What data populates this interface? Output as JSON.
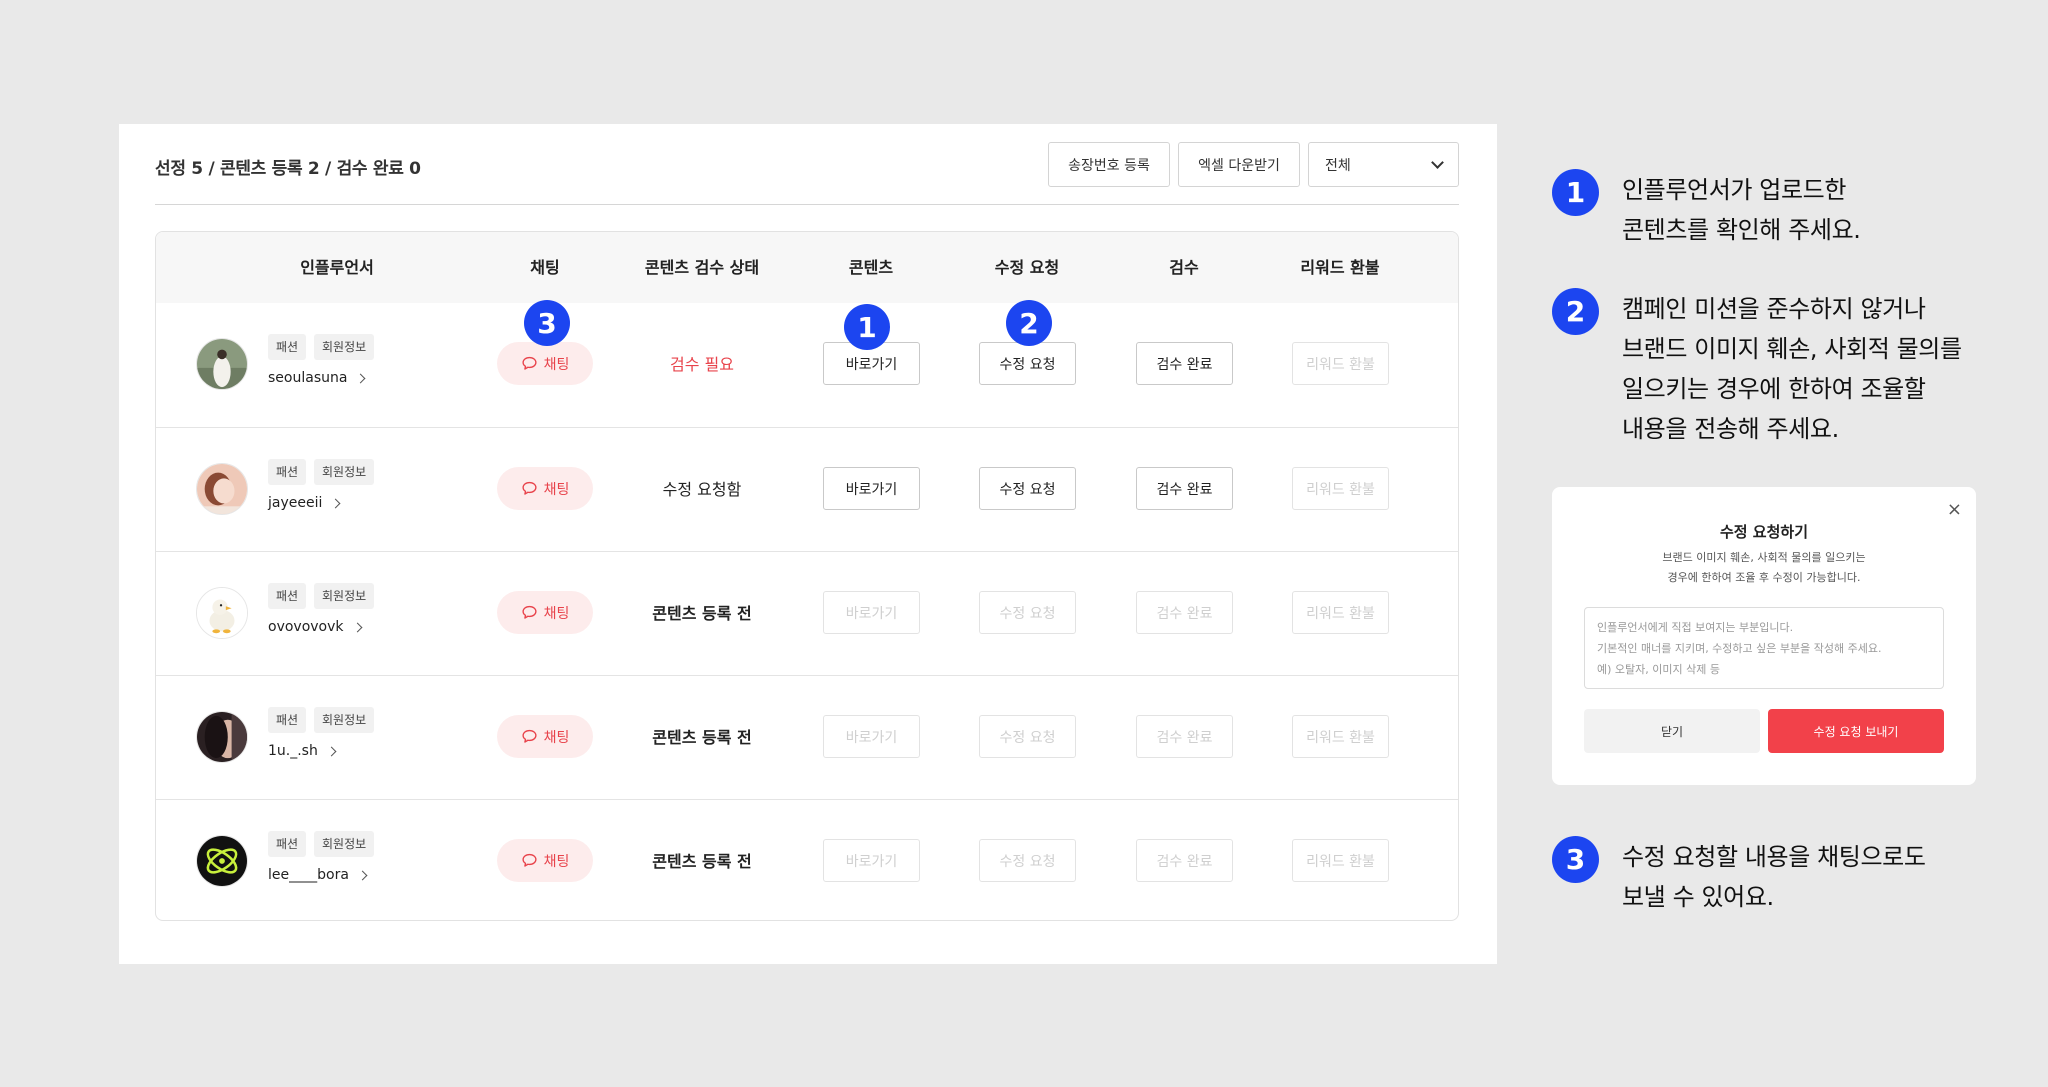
{
  "toolbar": {
    "summary": "선정 5 / 콘텐츠 등록 2 / 검수 완료 0",
    "register_tracking_label": "송장번호 등록",
    "excel_download_label": "엑셀 다운받기",
    "filter_selected": "전체"
  },
  "table": {
    "headers": [
      "인플루언서",
      "채팅",
      "콘텐츠 검수 상태",
      "콘텐츠",
      "수정 요청",
      "검수",
      "리워드 환불"
    ],
    "rows": [
      {
        "category": "패션",
        "member_info": "회원정보",
        "username": "seoulasuna",
        "chat": "채팅",
        "status": "검수 필요",
        "goto": "바로가기",
        "revise": "수정 요청",
        "approve": "검수 완료",
        "refund": "리워드 환불"
      },
      {
        "category": "패션",
        "member_info": "회원정보",
        "username": "jayeeeii",
        "chat": "채팅",
        "status": "수정 요청함",
        "goto": "바로가기",
        "revise": "수정 요청",
        "approve": "검수 완료",
        "refund": "리워드 환불"
      },
      {
        "category": "패션",
        "member_info": "회원정보",
        "username": "ovovovovk",
        "chat": "채팅",
        "status": "콘텐츠 등록 전",
        "goto": "바로가기",
        "revise": "수정 요청",
        "approve": "검수 완료",
        "refund": "리워드 환불"
      },
      {
        "category": "패션",
        "member_info": "회원정보",
        "username": "1u._.sh",
        "chat": "채팅",
        "status": "콘텐츠 등록 전",
        "goto": "바로가기",
        "revise": "수정 요청",
        "approve": "검수 완료",
        "refund": "리워드 환불"
      },
      {
        "category": "패션",
        "member_info": "회원정보",
        "username": "lee____bora",
        "chat": "채팅",
        "status": "콘텐츠 등록 전",
        "goto": "바로가기",
        "revise": "수정 요청",
        "approve": "검수 완료",
        "refund": "리워드 환불"
      }
    ]
  },
  "markers": {
    "one": "1",
    "two": "2",
    "three": "3"
  },
  "notes": [
    {
      "number": "1",
      "line1": "인플루언서가 업로드한",
      "line2": "콘텐츠를 확인해 주세요."
    },
    {
      "number": "2",
      "line1": "캠페인 미션을 준수하지 않거나",
      "line2": "브랜드 이미지 훼손, 사회적 물의를",
      "line3": "일으키는 경우에 한하여 조율할",
      "line4": "내용을 전송해 주세요."
    },
    {
      "number": "3",
      "line1": "수정 요청할 내용을 채팅으로도",
      "line2": "보낼 수 있어요."
    }
  ],
  "modal": {
    "close_glyph": "×",
    "title": "수정 요청하기",
    "desc_line1": "브랜드 이미지 훼손, 사회적 물의를 일으키는",
    "desc_line2": "경우에 한하여 조율 후 수정이 가능합니다.",
    "placeholder_line1": "인플루언서에게 직접 보여지는 부분입니다.",
    "placeholder_line2": "기본적인 매너를 지키며, 수정하고 싶은 부분을 작성해 주세요.",
    "placeholder_line3": "예) 오탈자, 이미지 삭제 등",
    "close_button": "닫기",
    "send_button": "수정 요청 보내기"
  },
  "colors": {
    "accent_blue": "#1c45f0",
    "alert_red": "#e8434b",
    "send_red": "#f2414a"
  },
  "icons": {
    "chat": "chat-bubble-icon",
    "dropdown": "chevron-down-icon",
    "row_link": "chevron-right-icon"
  }
}
